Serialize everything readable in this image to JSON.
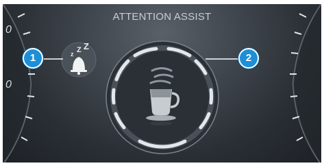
{
  "screen": {
    "title": "ATTENTION ASSIST"
  },
  "callouts": [
    {
      "number": "1",
      "points_to": "sleep-warning-icon"
    },
    {
      "number": "2",
      "points_to": "attention-level-ring"
    }
  ],
  "sleep_icon": {
    "zzz": [
      "z",
      "Z",
      "Z"
    ]
  },
  "icons": {
    "sleep": "bell-with-zzz-icon",
    "coffee": "coffee-cup-icon",
    "steam": "steam-icon"
  },
  "colors": {
    "callout_fill": "#1e8fd6",
    "display_background": "#3f454c",
    "ring": "#d8dcdf"
  }
}
